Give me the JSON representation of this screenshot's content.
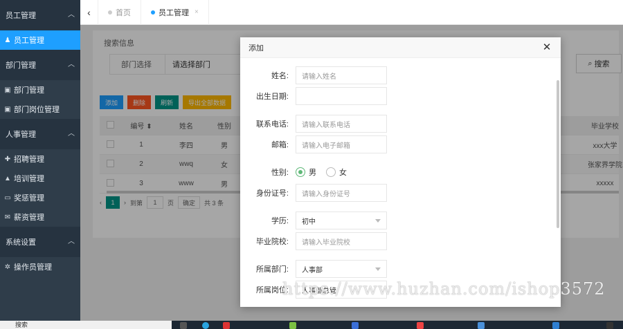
{
  "sidebar": {
    "groups": [
      {
        "label": "员工管理",
        "items": [
          {
            "label": "员工管理",
            "icon": "person-icon",
            "active": true
          }
        ]
      },
      {
        "label": "部门管理",
        "items": [
          {
            "label": "部门管理",
            "icon": "id-card-icon"
          },
          {
            "label": "部门岗位管理",
            "icon": "id-card-icon"
          }
        ]
      },
      {
        "label": "人事管理",
        "items": [
          {
            "label": "招聘管理",
            "icon": "user-plus-icon"
          },
          {
            "label": "培训管理",
            "icon": "graduation-cap-icon"
          },
          {
            "label": "奖惩管理",
            "icon": "monitor-icon"
          },
          {
            "label": "薪资管理",
            "icon": "envelope-icon"
          }
        ]
      },
      {
        "label": "系统设置",
        "items": [
          {
            "label": "操作员管理",
            "icon": "gears-icon"
          }
        ]
      }
    ]
  },
  "tabs": [
    {
      "label": "首页"
    },
    {
      "label": "员工管理",
      "closable": true
    }
  ],
  "search": {
    "title": "搜索信息",
    "dept_label": "部门选择",
    "dept_value": "请选择部门",
    "button": "搜索"
  },
  "toolbar": {
    "add": "添加",
    "delete": "删除",
    "refresh": "刷新",
    "export": "导出全部数据"
  },
  "table": {
    "headers": [
      "编号",
      "姓名",
      "性别",
      "毕业学校"
    ],
    "rows": [
      {
        "id": "1",
        "name": "李四",
        "gender": "男",
        "school": "xxx大学"
      },
      {
        "id": "2",
        "name": "wwq",
        "gender": "女",
        "school": "张家界学院"
      },
      {
        "id": "3",
        "name": "www",
        "gender": "男",
        "school": "xxxxx"
      }
    ]
  },
  "pager": {
    "current": "1",
    "goto": "到第",
    "page_input": "1",
    "page_unit": "页",
    "confirm": "确定",
    "total": "共 3 条"
  },
  "modal": {
    "title": "添加",
    "fields": {
      "name_label": "姓名:",
      "name_placeholder": "请输入姓名",
      "birth_label": "出生日期:",
      "phone_label": "联系电话:",
      "phone_placeholder": "请输入联系电话",
      "email_label": "邮箱:",
      "email_placeholder": "请输入电子邮箱",
      "gender_label": "性别:",
      "gender_male": "男",
      "gender_female": "女",
      "idcard_label": "身份证号:",
      "idcard_placeholder": "请输入身份证号",
      "edu_label": "学历:",
      "edu_value": "初中",
      "school_label": "毕业院校:",
      "school_placeholder": "请输入毕业院校",
      "dept_label": "所属部门:",
      "dept_value": "人事部",
      "post_label": "所属岗位:",
      "post_value": "人事部总管"
    }
  },
  "watermark": "https://www.huzhan.com/ishop3572",
  "taskbar": {
    "search": "搜索"
  },
  "colors": {
    "sidebar": "#2f3d4a",
    "accent": "#1e9fff",
    "green": "#009688",
    "add_btn": "#1e9fff",
    "del_btn": "#ff5722",
    "refresh_btn": "#009688",
    "export_btn": "#ffb800"
  }
}
